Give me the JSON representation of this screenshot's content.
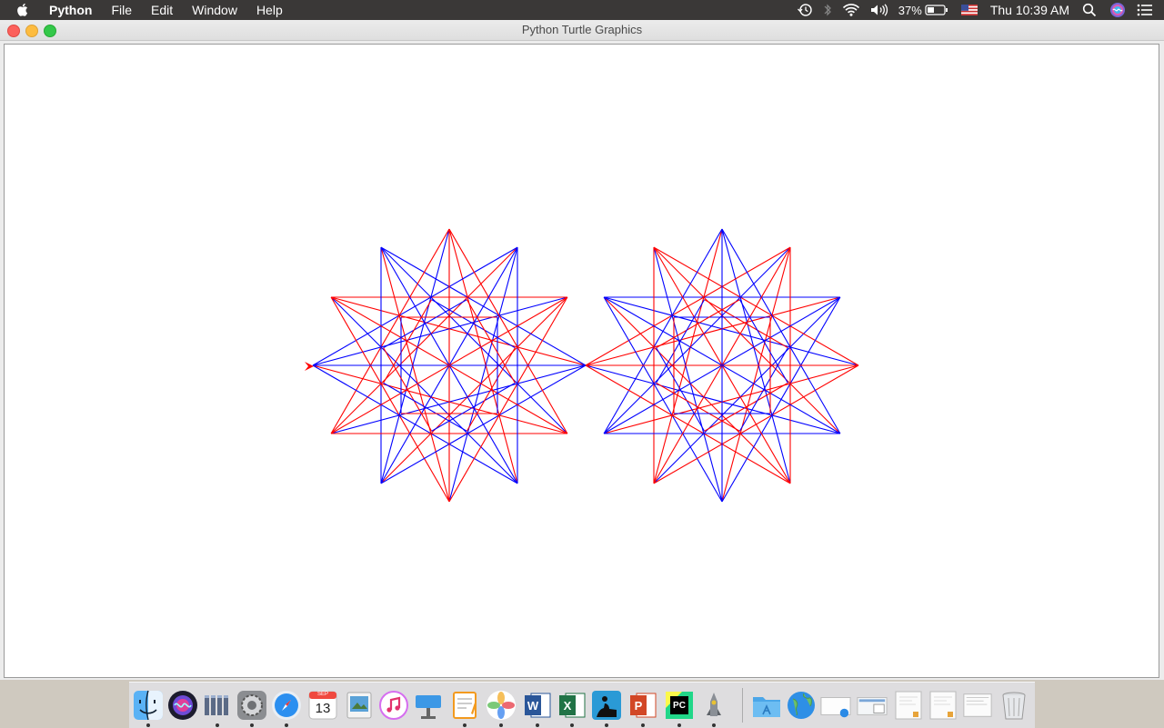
{
  "menubar": {
    "app_name": "Python",
    "menus": [
      "File",
      "Edit",
      "Window",
      "Help"
    ],
    "battery_percent": "37%",
    "clock": "Thu 10:39 AM",
    "icons": [
      "apple-icon",
      "time-machine-icon",
      "bluetooth-icon",
      "wifi-icon",
      "volume-icon",
      "battery-icon",
      "us-flag-icon",
      "spotlight-search-icon",
      "siri-icon",
      "notification-center-icon"
    ]
  },
  "window": {
    "title": "Python Turtle Graphics"
  },
  "drawing": {
    "colors": {
      "red": "#ff0000",
      "blue": "#0000ff"
    },
    "turtle_color": "#ff0000",
    "figures": [
      "left-star",
      "right-star"
    ]
  },
  "dock": {
    "calendar_month": "SEP",
    "calendar_day": "13",
    "apps": [
      "Finder",
      "Siri",
      "Library",
      "System Preferences",
      "Safari",
      "Calendar",
      "Preview",
      "iTunes",
      "Keynote",
      "Pages",
      "Photos",
      "Microsoft Word",
      "Microsoft Excel",
      "Kindle",
      "Microsoft PowerPoint",
      "PyCharm",
      "Python Launcher"
    ],
    "others": [
      "Applications",
      "Network",
      "Screenshot 1",
      "Screenshot 2",
      "Document 1",
      "Document 2",
      "Document 3",
      "Trash"
    ],
    "accent": "#1e7cf0"
  }
}
